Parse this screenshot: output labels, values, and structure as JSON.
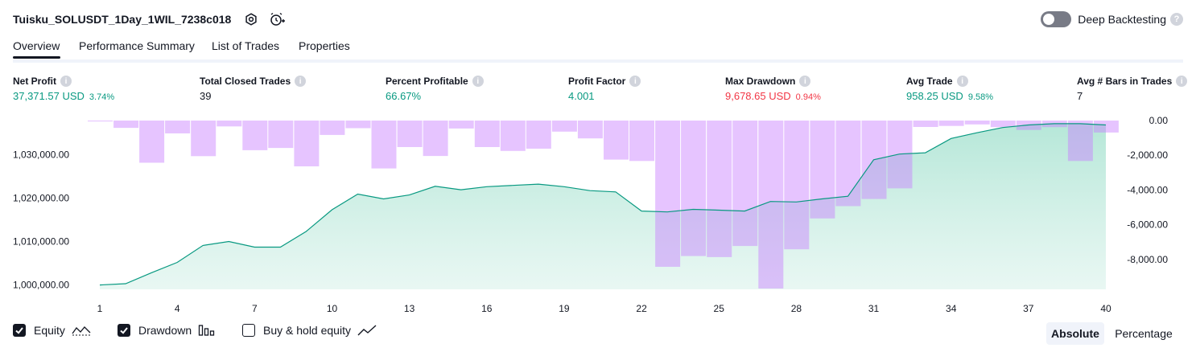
{
  "header": {
    "strategy_title": "Tuisku_SOLUSDT_1Day_1WIL_7238c018",
    "settings_icon": "gear-icon",
    "alert_icon": "alarm-clock-plus-icon",
    "deep_backtesting_label": "Deep Backtesting",
    "deep_backtesting_enabled": false,
    "help_glyph": "?"
  },
  "tabs": [
    {
      "label": "Overview",
      "active": true
    },
    {
      "label": "Performance Summary",
      "active": false
    },
    {
      "label": "List of Trades",
      "active": false
    },
    {
      "label": "Properties",
      "active": false
    }
  ],
  "info_glyph": "i",
  "metrics": [
    {
      "label": "Net Profit",
      "value": "37,371.57 USD",
      "pct": "3.74%",
      "color": "#089981"
    },
    {
      "label": "Total Closed Trades",
      "value": "39",
      "pct": "",
      "color": "#131722"
    },
    {
      "label": "Percent Profitable",
      "value": "66.67%",
      "pct": "",
      "color": "#089981"
    },
    {
      "label": "Profit Factor",
      "value": "4.001",
      "pct": "",
      "color": "#089981"
    },
    {
      "label": "Max Drawdown",
      "value": "9,678.65 USD",
      "pct": "0.94%",
      "color": "#f23645"
    },
    {
      "label": "Avg Trade",
      "value": "958.25 USD",
      "pct": "9.58%",
      "color": "#089981"
    },
    {
      "label": "Avg # Bars in Trades",
      "value": "7",
      "pct": "",
      "color": "#131722"
    }
  ],
  "chart_data": {
    "type": "area",
    "x": [
      1,
      2,
      3,
      4,
      5,
      6,
      7,
      8,
      9,
      10,
      11,
      12,
      13,
      14,
      15,
      16,
      17,
      18,
      19,
      20,
      21,
      22,
      23,
      24,
      25,
      26,
      27,
      28,
      29,
      30,
      31,
      32,
      33,
      34,
      35,
      36,
      37,
      38,
      39,
      40
    ],
    "x_tick_labels": [
      "1",
      "4",
      "7",
      "10",
      "13",
      "16",
      "19",
      "22",
      "25",
      "28",
      "31",
      "34",
      "37",
      "40"
    ],
    "left_axis": {
      "ticks": [
        "1,000,000.00",
        "1,010,000.00",
        "1,020,000.00",
        "1,030,000.00"
      ],
      "tick_values": [
        1000000,
        1010000,
        1020000,
        1030000
      ],
      "range": [
        999000,
        1038000
      ]
    },
    "right_axis": {
      "ticks": [
        "0.00",
        "-2,000.00",
        "-4,000.00",
        "-6,000.00",
        "-8,000.00"
      ],
      "tick_values": [
        0,
        -2000,
        -4000,
        -6000,
        -8000
      ],
      "range": [
        -9678.65,
        0
      ]
    },
    "series": [
      {
        "name": "Equity",
        "kind": "area",
        "color": "#089981",
        "values": [
          1000000,
          1000300,
          1002800,
          1005200,
          1009100,
          1010000,
          1008700,
          1008700,
          1012300,
          1017300,
          1020900,
          1019800,
          1020700,
          1022700,
          1021900,
          1022600,
          1022900,
          1023200,
          1022600,
          1021700,
          1021400,
          1017000,
          1016800,
          1017400,
          1017200,
          1017000,
          1019200,
          1019100,
          1019800,
          1020400,
          1028800,
          1030100,
          1030400,
          1033700,
          1035000,
          1036200,
          1036800,
          1037100,
          1037100,
          1036800
        ]
      },
      {
        "name": "Drawdown",
        "kind": "bar",
        "color": "#c27ff8",
        "values": [
          -50,
          -420,
          -2430,
          -740,
          -2050,
          -340,
          -1710,
          -1580,
          -2640,
          -830,
          -440,
          -2760,
          -1530,
          -2040,
          -460,
          -1530,
          -1750,
          -1620,
          -640,
          -1030,
          -2250,
          -2330,
          -8430,
          -7810,
          -7870,
          -7230,
          -9678.65,
          -7420,
          -5640,
          -4930,
          -4520,
          -3910,
          -370,
          -310,
          -220,
          -380,
          -540,
          -380,
          -2330,
          -690
        ]
      }
    ],
    "grid": false
  },
  "legend": [
    {
      "label": "Equity",
      "checked": true,
      "icon": "equity-line-icon"
    },
    {
      "label": "Drawdown",
      "checked": true,
      "icon": "drawdown-bars-icon"
    },
    {
      "label": "Buy & hold equity",
      "checked": false,
      "icon": "buy-hold-line-icon"
    }
  ],
  "view_modes": [
    {
      "label": "Absolute",
      "active": true
    },
    {
      "label": "Percentage",
      "active": false
    }
  ]
}
